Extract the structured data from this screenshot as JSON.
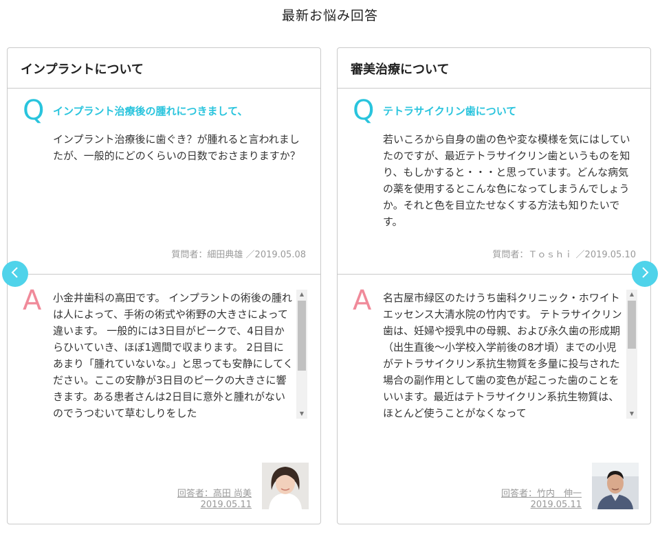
{
  "page": {
    "title": "最新お悩み回答"
  },
  "cards": [
    {
      "category": "インプラントについて",
      "question": {
        "mark": "Q",
        "title": "インプラント治療後の腫れにつきまして、",
        "body": "インプラント治療後に歯ぐき？が腫れると言われましたが、一般的にどのくらいの日数でおさまりますか？",
        "asker": "質問者：細田典雄 ／2019.05.08"
      },
      "answer": {
        "mark": "A",
        "body": "小金井歯科の高田です。 インプラントの術後の腫れは人によって、手術の術式や術野の大きさによって違います。 一般的には3日目がピークで、4日目からひいていき、ほぼ1週間で収まります。 2日目にあまり「腫れていないな。」と思っても安静にしてください。ここの安静が3日目のピークの大きさに響きます。ある患者さんは2日目に意外と腫れがないのでうつむいて草むしりをした",
        "answerer": "回答者：高田 尚美",
        "date": "2019.05.11"
      }
    },
    {
      "category": "審美治療について",
      "question": {
        "mark": "Q",
        "title": "テトラサイクリン歯について",
        "body": "若いころから自身の歯の色や変な模様を気にはしていたのですが、最近テトラサイクリン歯というものを知り、もしかすると・・・と思っています。どんな病気の薬を使用するとこんな色になってしまうんでしょうか。それと色を目立たせなくする方法も知りたいです。",
        "asker": "質問者：Ｔｏｓｈｉ ／2019.05.10"
      },
      "answer": {
        "mark": "A",
        "body": "名古屋市緑区のたけうち歯科クリニック・ホワイトエッセンス大清水院の竹内です。 テトラサイクリン歯は、妊婦や授乳中の母親、および永久歯の形成期（出生直後～小学校入学前後の8才頃）までの小児がテトラサイクリン系抗生物質を多量に投与された場合の副作用として歯の変色が起こった歯のことをいいます。最近はテトラサイクリン系抗生物質は、ほとんど使うことがなくなって",
        "answerer": "回答者：竹内　伸一",
        "date": "2019.05.11"
      }
    }
  ],
  "nav": {
    "prev_icon": "chevron-left-icon",
    "next_icon": "chevron-right-icon"
  },
  "colors": {
    "q_accent": "#29c4dd",
    "a_accent": "#f08a9a",
    "nav_button": "#4fd3ea"
  }
}
